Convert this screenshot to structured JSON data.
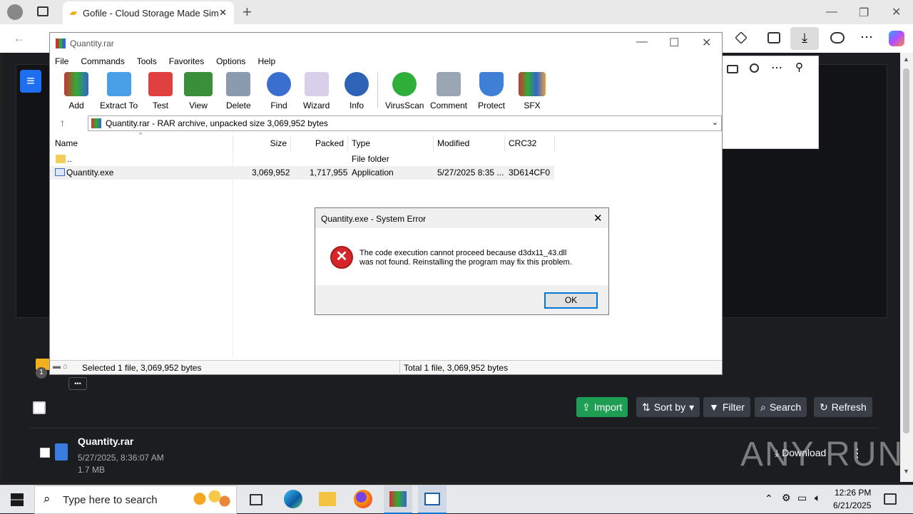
{
  "browser": {
    "tab_title": "Gofile - Cloud Storage Made Simp",
    "close_tab": "✕",
    "new_tab": "+",
    "win_min": "—",
    "win_max": "❐",
    "win_close": "✕",
    "back": "←",
    "more": "⋯"
  },
  "page": {
    "menu_icon": "≡",
    "buttons": {
      "import": "Import",
      "sort": "Sort by",
      "filter": "Filter",
      "search": "Search",
      "refresh": "Refresh"
    },
    "more_dots": "•••",
    "file": {
      "name": "Quantity.rar",
      "date": "5/27/2025, 8:36:07 AM",
      "size": "1.7 MB",
      "download": "Download"
    },
    "badge_count": "1",
    "watermark": "ANY RUN"
  },
  "rar": {
    "title": "Quantity.rar",
    "menu": [
      "File",
      "Commands",
      "Tools",
      "Favorites",
      "Options",
      "Help"
    ],
    "toolbar": [
      "Add",
      "Extract To",
      "Test",
      "View",
      "Delete",
      "Find",
      "Wizard",
      "Info",
      "VirusScan",
      "Comment",
      "Protect",
      "SFX"
    ],
    "address": "Quantity.rar - RAR archive, unpacked size 3,069,952 bytes",
    "columns": {
      "name": "Name",
      "size": "Size",
      "packed": "Packed",
      "type": "Type",
      "modified": "Modified",
      "crc": "CRC32"
    },
    "rows": [
      {
        "name": "..",
        "size": "",
        "packed": "",
        "type": "File folder",
        "modified": "",
        "crc": ""
      },
      {
        "name": "Quantity.exe",
        "size": "3,069,952",
        "packed": "1,717,955",
        "type": "Application",
        "modified": "5/27/2025 8:35 ...",
        "crc": "3D614CF0"
      }
    ],
    "status_left": "Selected 1 file, 3,069,952 bytes",
    "status_right": "Total 1 file, 3,069,952 bytes"
  },
  "dialog": {
    "title": "Quantity.exe - System Error",
    "line1": "The code execution cannot proceed because d3dx11_43.dll",
    "line2": "was not found. Reinstalling the program may fix this problem.",
    "ok": "OK",
    "close": "✕"
  },
  "taskbar": {
    "search_placeholder": "Type here to search",
    "time": "12:26 PM",
    "date": "6/21/2025"
  },
  "colors": {
    "import_green": "#1e9e55",
    "toolbar_btn": "#3a3f47",
    "error_red": "#d7262a",
    "hamb_blue": "#1e6ff0"
  }
}
